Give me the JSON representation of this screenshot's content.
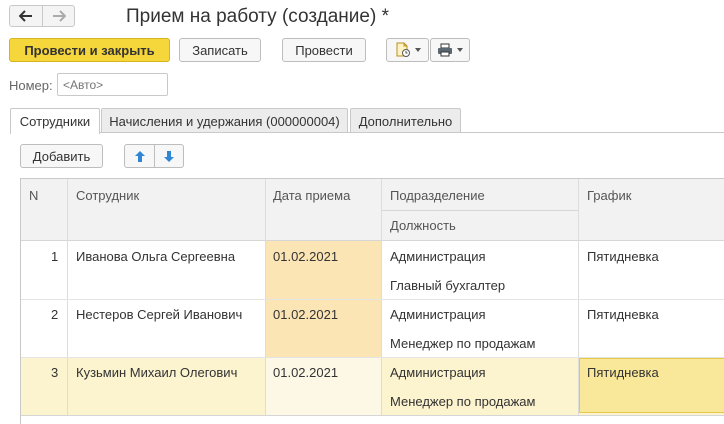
{
  "window": {
    "title": "Прием на работу (создание) *"
  },
  "nav": {
    "back_icon": "arrow-left-icon",
    "forward_icon": "arrow-right-icon"
  },
  "toolbar": {
    "post_close_label": "Провести и закрыть",
    "save_label": "Записать",
    "post_label": "Провести",
    "create_based_icon": "create-based-on-icon",
    "print_icon": "printer-icon"
  },
  "header_fields": {
    "number_label": "Номер:",
    "number_placeholder": "<Авто>",
    "number_value": ""
  },
  "tabs": [
    {
      "label": "Сотрудники",
      "active": true
    },
    {
      "label": "Начисления и удержания (000000004)",
      "active": false
    },
    {
      "label": "Дополнительно",
      "active": false
    }
  ],
  "table_toolbar": {
    "add_label": "Добавить",
    "move_up_icon": "arrow-up-icon",
    "move_down_icon": "arrow-down-icon"
  },
  "table": {
    "columns": {
      "n": "N",
      "employee": "Сотрудник",
      "hire_date": "Дата приема",
      "department": "Подразделение",
      "position": "Должность",
      "schedule": "График"
    },
    "rows": [
      {
        "n": "1",
        "employee": "Иванова Ольга Сергеевна",
        "hire_date": "01.02.2021",
        "department": "Администрация",
        "position": "Главный бухгалтер",
        "schedule": "Пятидневка"
      },
      {
        "n": "2",
        "employee": "Нестеров Сергей Иванович",
        "hire_date": "01.02.2021",
        "department": "Администрация",
        "position": "Менеджер по продажам",
        "schedule": "Пятидневка"
      },
      {
        "n": "3",
        "employee": "Кузьмин Михаил Олегович",
        "hire_date": "01.02.2021",
        "department": "Администрация",
        "position": "Менеджер по продажам",
        "schedule": "Пятидневка"
      }
    ],
    "selected_row_index": 2
  },
  "colors": {
    "primary_button": "#f5d63b",
    "date_highlight": "#fce5b4",
    "selected_row": "#fcf3cf",
    "selected_cell": "#fae89a",
    "selected_cell_border": "#e8c84a"
  }
}
